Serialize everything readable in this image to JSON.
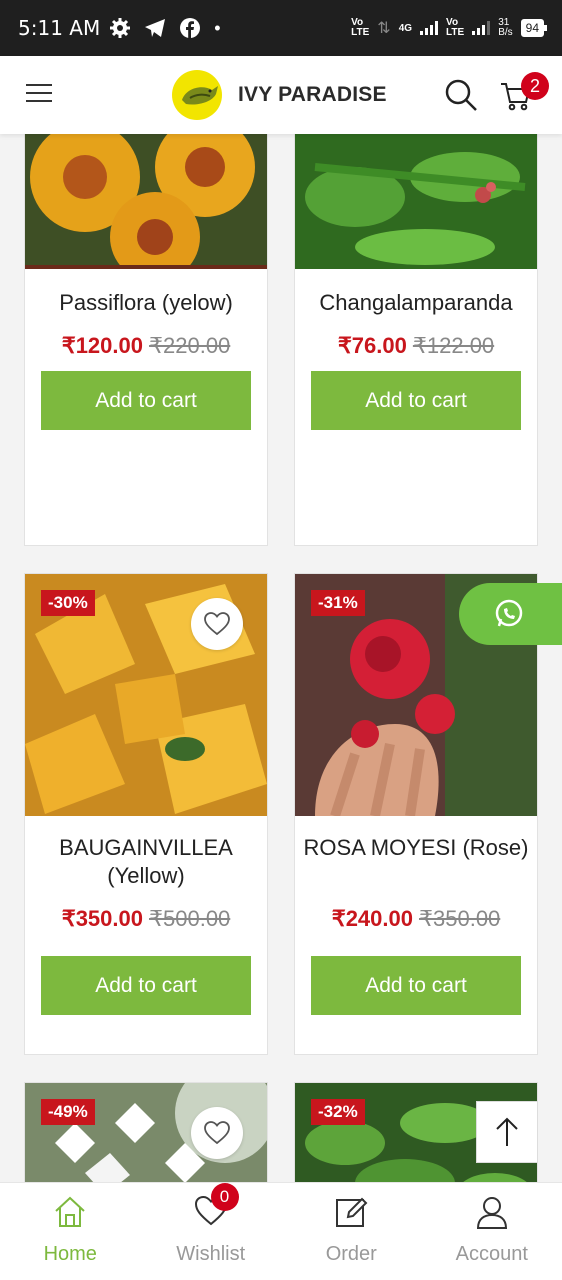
{
  "status_bar": {
    "time": "5:11 AM",
    "net_left": "Vo\nLTE",
    "net_4g": "4G",
    "net_right": "Vo\nLTE",
    "speed": "31\nB/s",
    "battery": "94"
  },
  "header": {
    "logo_text": "IVY PARADISE",
    "cart_count": "2"
  },
  "products": [
    {
      "name": "Passiflora (yelow)",
      "price": "₹120.00",
      "old_price": "₹220.00",
      "discount": "",
      "button": "Add to cart"
    },
    {
      "name": "Changalamparanda",
      "price": "₹76.00",
      "old_price": "₹122.00",
      "discount": "",
      "button": "Add to cart"
    },
    {
      "name": "BAUGAINVILLEA (Yellow)",
      "price": "₹350.00",
      "old_price": "₹500.00",
      "discount": "-30%",
      "button": "Add to cart"
    },
    {
      "name": "ROSA MOYESI (Rose)",
      "price": "₹240.00",
      "old_price": "₹350.00",
      "discount": "-31%",
      "button": "Add to cart"
    },
    {
      "name": "",
      "price": "",
      "old_price": "",
      "discount": "-49%",
      "button": ""
    },
    {
      "name": "",
      "price": "",
      "old_price": "",
      "discount": "-32%",
      "button": ""
    }
  ],
  "bottom_nav": {
    "home": "Home",
    "wishlist": "Wishlist",
    "wishlist_count": "0",
    "order": "Order",
    "account": "Account"
  },
  "colors": {
    "accent_green": "#7db93e",
    "sale_red": "#c8161d",
    "whatsapp_green": "#6fc143"
  }
}
